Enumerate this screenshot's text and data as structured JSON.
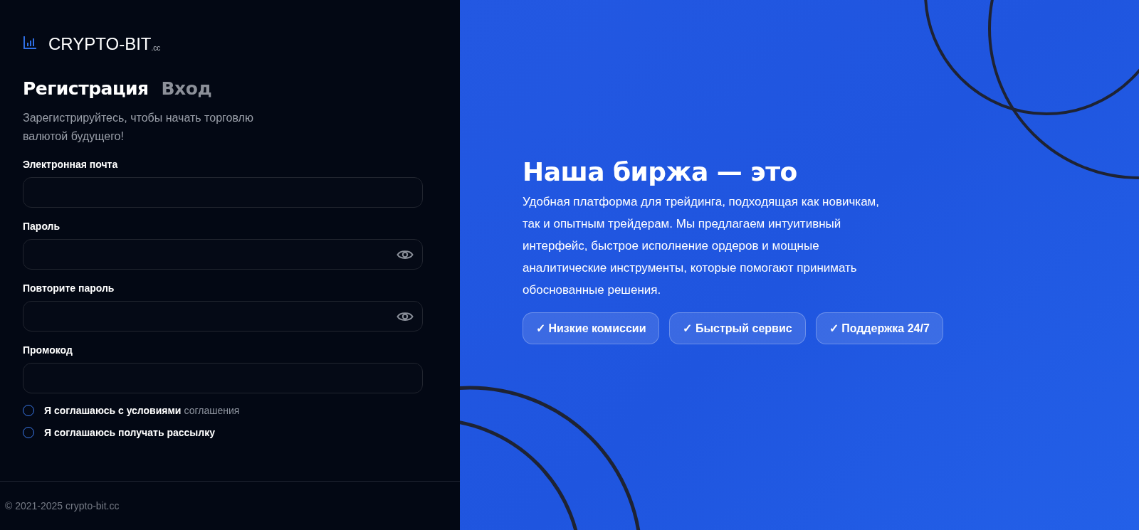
{
  "logo": {
    "name": "CRYPTO-BIT",
    "suffix": ".cc"
  },
  "tabs": [
    {
      "label": "Регистрация",
      "selected": true
    },
    {
      "label": "Вход",
      "selected": false
    }
  ],
  "subtitle": "Зарегистрируйтесь, чтобы начать торговлю валютой будущего!",
  "fields": [
    {
      "label": "Электронная почта",
      "kind": "text"
    },
    {
      "label": "Пароль",
      "kind": "password"
    },
    {
      "label": "Повторите пароль",
      "kind": "password"
    },
    {
      "label": "Промокод",
      "kind": "text"
    }
  ],
  "consents": [
    {
      "label": "Я соглашаюсь с условиями",
      "link": "соглашения",
      "checked": false
    },
    {
      "label": "Я соглашаюсь получать рассылку",
      "checked": false
    }
  ],
  "footer": "© 2021-2025 crypto-bit.cc",
  "promo": {
    "heading": "Наша биржа — это",
    "text": "Удобная платформа для трейдинга, подходящая как новичкам, так и опытным трейдерам. Мы предлагаем интуитивный интерфейс, быстрое исполнение ордеров и мощные аналитические инструменты, которые помогают принимать обоснованные решения.",
    "features": [
      "✓ Низкие комиссии",
      "✓ Быстрый сервис",
      "✓ Поддержка 24/7"
    ]
  }
}
